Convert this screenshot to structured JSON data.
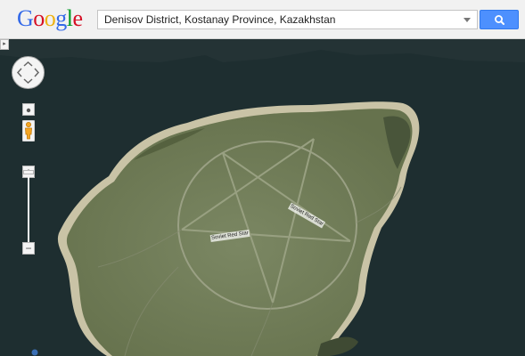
{
  "header": {
    "logo_letters": [
      {
        "char": "G",
        "color": "#3369e8"
      },
      {
        "char": "o",
        "color": "#d50f25"
      },
      {
        "char": "o",
        "color": "#eeb211"
      },
      {
        "char": "g",
        "color": "#3369e8"
      },
      {
        "char": "l",
        "color": "#009925"
      },
      {
        "char": "e",
        "color": "#d50f25"
      }
    ],
    "search_value": "Denisov District, Kostanay Province, Kazakhstan",
    "search_button_icon": "search-icon",
    "dropdown_icon": "dropdown-caret-icon"
  },
  "map": {
    "view": "satellite",
    "road_labels": [
      "Soviet Red Star",
      "Soviet Red Star"
    ],
    "colors": {
      "water": "#1e2e30",
      "land": "#6f7c56",
      "shore": "#c9c3a6",
      "tracks": "#8d9278"
    }
  },
  "controls": {
    "pan_icon": "pan-arrows-icon",
    "streetview_icon": "pegman-icon",
    "zoom_in_label": "+",
    "zoom_out_label": "−",
    "edge_toggle_label": "▸"
  }
}
